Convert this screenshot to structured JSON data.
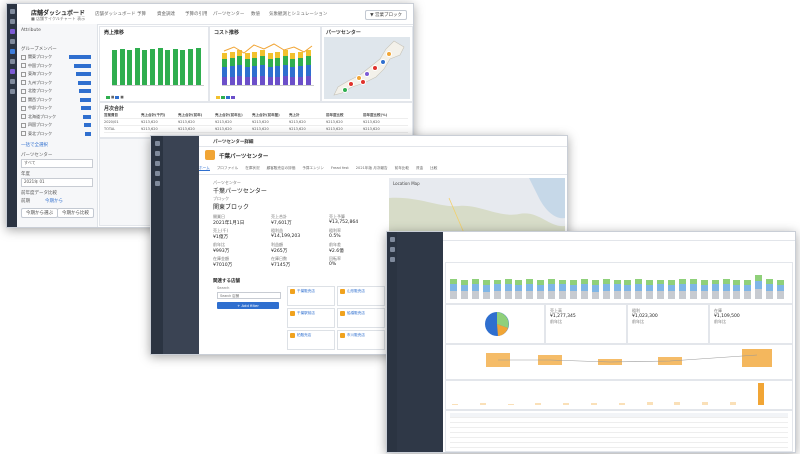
{
  "screen1": {
    "app_title": "店舗ダッシュボード",
    "app_sub": "■ 店舗サイクルチャート 表示",
    "nav": [
      "店舗ダッシュボード",
      "予算",
      "資金調達",
      "予算の引用",
      "パーツセンター",
      "数値",
      "気象観測とシミュレーション"
    ],
    "action_button": "▼ 営業ブロック",
    "filter": {
      "search_label": "Attribute",
      "group_label": "グループメンバー",
      "items": [
        {
          "label": "関東ブロック",
          "share": 0.9
        },
        {
          "label": "中国ブロック",
          "share": 0.72
        },
        {
          "label": "東海ブロック",
          "share": 0.62
        },
        {
          "label": "九州ブロック",
          "share": 0.55
        },
        {
          "label": "北陸ブロック",
          "share": 0.48
        },
        {
          "label": "関西ブロック",
          "share": 0.45
        },
        {
          "label": "中部ブロック",
          "share": 0.4
        },
        {
          "label": "北海道ブロック",
          "share": 0.35
        },
        {
          "label": "四国ブロック",
          "share": 0.3
        },
        {
          "label": "東北ブロック",
          "share": 0.25
        }
      ],
      "link": "一括で全選択",
      "parts_label": "パーツセンター",
      "parts_value": "すべて",
      "year_label": "年度",
      "year_value": "2021年 01",
      "compare_label": "前年度データ比較",
      "toggle_on": "前期",
      "toggle_off": "今期から",
      "button_a": "今期から選ぶ",
      "button_b": "今期から比較"
    },
    "cards": {
      "sales": "売上推移",
      "cost": "コスト推移",
      "parts": "パーツセンター"
    },
    "table_title": "月次合計",
    "table_headers": [
      "営業費目",
      "売上合計(千円)",
      "売上合計(前年)",
      "売上合計(前年比)",
      "売上合計(前年差)",
      "売上計",
      "前年度比較",
      "前年度比較(%)"
    ],
    "table_rows": [
      [
        "2020/01",
        "¥213,620",
        "¥213,620",
        "¥213,620",
        "¥213,620",
        "¥213,620",
        "¥213,620",
        "¥213,620"
      ],
      [
        "TOTAL",
        "¥213,620",
        "¥213,620",
        "¥213,620",
        "¥213,620",
        "¥213,620",
        "¥213,620",
        "¥213,620"
      ]
    ]
  },
  "screen2": {
    "header": "パーツセンター詳細",
    "title": "千葉パーツセンター",
    "tabs": [
      "ホーム",
      "プロファイル",
      "在庫状況",
      "顧客販売店の評価",
      "予算エンジン",
      "Fread fest",
      "2021年版 月次報告",
      "前年比較",
      "資金",
      "比較"
    ],
    "center_label": "パーツセンター",
    "center_name": "千葉パーツセンター",
    "block_label": "ブロック",
    "block_name": "関東ブロック",
    "kpis": [
      {
        "label": "開業日",
        "value": "2021年1月1日"
      },
      {
        "label": "売上合計",
        "value": "¥7,601万"
      },
      {
        "label": "売上予算",
        "value": "¥13,752,864"
      },
      {
        "label": "売上(千)",
        "value": "¥1億万"
      },
      {
        "label": "粗利益",
        "value": "¥14,199,203"
      },
      {
        "label": "粗利率",
        "value": "0.5%"
      },
      {
        "label": "前年比",
        "value": "¥993万"
      },
      {
        "label": "利益額",
        "value": "¥265万"
      },
      {
        "label": "前年差",
        "value": "¥2.6億"
      },
      {
        "label": "在庫金額",
        "value": "¥7010万"
      },
      {
        "label": "在庫日数",
        "value": "¥7145万"
      },
      {
        "label": "回転率",
        "value": "0%"
      }
    ],
    "section_title": "関連する店舗",
    "search_label": "Search",
    "search_placeholder": "Search 店舗",
    "add_button": "+ Add filter",
    "related": [
      "千葉販売店",
      "山形販売店",
      "千葉駅前店",
      "船橋販売店",
      "柏販売店",
      "市川販売店"
    ],
    "map_label": "Location Map"
  },
  "screen3": {
    "bar_heights": [
      0.62,
      0.6,
      0.64,
      0.58,
      0.61,
      0.63,
      0.59,
      0.62,
      0.6,
      0.64,
      0.61,
      0.6,
      0.62,
      0.58,
      0.63,
      0.61,
      0.6,
      0.62,
      0.59,
      0.61,
      0.6,
      0.63,
      0.62,
      0.6,
      0.61,
      0.64,
      0.59,
      0.6,
      0.75,
      0.62,
      0.6
    ],
    "pie": [
      0.55,
      0.3,
      0.15
    ],
    "kpi_labels": [
      "売上高",
      "粗利",
      "在庫"
    ],
    "kpi_values": [
      "¥1,277,345",
      "¥1,023,300",
      "¥1,109,500"
    ],
    "kpi_subs": [
      "前年比",
      "前年比",
      "前年比"
    ],
    "lower_bars": [
      0.3,
      0.4,
      0.35,
      0.45,
      0.5,
      0.6,
      0.55,
      0.65,
      0.7,
      0.75,
      0.8,
      1.0
    ],
    "colors": {
      "green": "#8fd07a",
      "blue": "#7fb6e6",
      "orange": "#f1a535",
      "gray": "#c7cbd1",
      "dark": "#2b3442",
      "accent": "#2f6fcf"
    }
  }
}
